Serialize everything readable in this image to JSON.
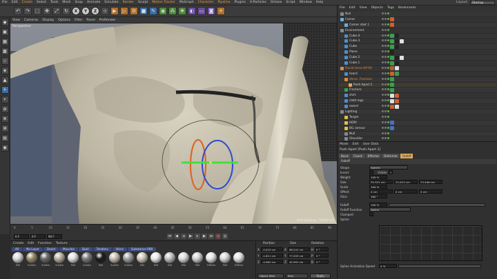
{
  "menubar": {
    "items": [
      "File",
      "Edit",
      "Create",
      "Select",
      "Tools",
      "Mesh",
      "Snap",
      "Animate",
      "Simulate",
      "Render",
      "Sculpt",
      "Motion Tracker",
      "MoGraph",
      "Character",
      "Pipeline",
      "Plugins",
      "X-Particles",
      "Octane",
      "Script",
      "Window",
      "Help"
    ],
    "highlighted": [
      "Create",
      "Render",
      "Motion Tracker",
      "Character",
      "Pipeline"
    ],
    "layout_label": "Layout:",
    "layout_value": "Startup"
  },
  "toolbar": {
    "buttons": [
      "undo-icon",
      "redo-icon",
      "select-icon",
      "move-icon",
      "scale-icon",
      "rotate-icon",
      "x-axis",
      "y-axis",
      "z-axis",
      "coordinate-system-icon",
      "render-view-icon",
      "render-picture-icon",
      "render-settings-icon",
      "cube-icon",
      "pen-icon",
      "subdivision-icon",
      "array-icon",
      "cloner-icon",
      "deformer-icon",
      "floor-icon",
      "camera-icon",
      "light-icon"
    ],
    "axis_labels": [
      "X",
      "Y",
      "Z"
    ]
  },
  "viewport": {
    "menu": [
      "View",
      "Cameras",
      "Display",
      "Options",
      "Filter",
      "Panel",
      "ProRender"
    ],
    "camera_label": "Perspective",
    "grid_spacing": "Grid Spacing : 10000 cm"
  },
  "timeline": {
    "ticks": [
      "0",
      "5",
      "10",
      "15",
      "20",
      "25",
      "30",
      "35",
      "40",
      "45",
      "50",
      "55",
      "60",
      "65",
      "70",
      "75",
      "80",
      "85",
      "90"
    ],
    "start_field": "0 F",
    "current_field": "0 F",
    "end_field": "90 F",
    "playback": [
      "first-frame-icon",
      "prev-key-icon",
      "prev-frame-icon",
      "play-icon",
      "next-frame-icon",
      "next-key-icon",
      "last-frame-icon",
      "record-icon",
      "autokey-icon"
    ]
  },
  "materials": {
    "menu": [
      "Create",
      "Edit",
      "Function",
      "Texture"
    ],
    "tabs": [
      "All",
      "No Layer",
      "David",
      "Muscles",
      "Skull",
      "Tendons",
      "Veins",
      "Substance PBR"
    ],
    "items": [
      {
        "name": "Mat",
        "color": "#d8d8d8"
      },
      {
        "name": "Substa",
        "color": "#9a8a6a"
      },
      {
        "name": "Substa",
        "color": "#6a6a6a"
      },
      {
        "name": "Substa",
        "color": "#b8b0a0"
      },
      {
        "name": "Mat",
        "color": "#e0e0e0"
      },
      {
        "name": "Substa",
        "color": "#7a7a7a"
      },
      {
        "name": "Mat",
        "color": "#1a1a1a"
      },
      {
        "name": "Substa",
        "color": "#c8c0b0"
      },
      {
        "name": "Substa",
        "color": "#a0a0a0"
      },
      {
        "name": "Mat",
        "color": "#d0c8b8"
      },
      {
        "name": "Mat",
        "color": "#e8e8e8"
      },
      {
        "name": "Mat",
        "color": "#c0c0c0"
      },
      {
        "name": "Mat",
        "color": "#dcdcdc"
      },
      {
        "name": "Mat",
        "color": "#cfcfcf"
      },
      {
        "name": "Diffuse",
        "color": "#e4e4e4"
      },
      {
        "name": "Mat",
        "color": "#d6d6d6"
      },
      {
        "name": "Diffuse",
        "color": "#e0e0e0"
      }
    ]
  },
  "coordinates": {
    "headers": [
      "Position",
      "Size",
      "Rotation"
    ],
    "rows": [
      {
        "axis": "X",
        "pos": "-0.019 cm",
        "size": "66.241 cm",
        "rot_label": "H",
        "rot": "0 °"
      },
      {
        "axis": "Y",
        "pos": "-1.811 cm",
        "size": "77.203 cm",
        "rot_label": "P",
        "rot": "0 °"
      },
      {
        "axis": "Z",
        "pos": "-4.982 cm",
        "size": "42.991 cm",
        "rot_label": "B",
        "rot": "0 °"
      }
    ],
    "mode_select": "Object (Rel)",
    "size_select": "Size",
    "apply_label": "Apply"
  },
  "objects": {
    "menu": [
      "File",
      "Edit",
      "View",
      "Objects",
      "Tags",
      "Bookmarks"
    ],
    "rows": [
      {
        "name": "Null",
        "indent": 0,
        "color": "#888888",
        "orange": false,
        "sel": false,
        "tags": []
      },
      {
        "name": "Camer",
        "indent": 0,
        "color": "#6ab0e0",
        "orange": false,
        "sel": false,
        "tags": [
          "#d06030"
        ]
      },
      {
        "name": "Camer shot 1",
        "indent": 1,
        "color": "#6ab0e0",
        "orange": false,
        "sel": false,
        "tags": [
          "#d06030"
        ]
      },
      {
        "name": "Environment",
        "indent": 0,
        "color": "#888888",
        "orange": false,
        "sel": false,
        "tags": []
      },
      {
        "name": "Cube.4",
        "indent": 1,
        "color": "#4a90d0",
        "orange": false,
        "sel": false,
        "tags": [
          "#3aa050",
          "#222222"
        ]
      },
      {
        "name": "Cube.3",
        "indent": 1,
        "color": "#4a90d0",
        "orange": false,
        "sel": false,
        "tags": [
          "#3aa050",
          "#222222",
          "#e0e0e0"
        ]
      },
      {
        "name": "Cube",
        "indent": 1,
        "color": "#4a90d0",
        "orange": false,
        "sel": false,
        "tags": [
          "#3aa050",
          "#222222"
        ]
      },
      {
        "name": "Plane",
        "indent": 1,
        "color": "#4a90d0",
        "orange": false,
        "sel": false,
        "tags": [
          "#222222"
        ]
      },
      {
        "name": "Cube.2",
        "indent": 1,
        "color": "#4a90d0",
        "orange": false,
        "sel": false,
        "tags": [
          "#3aa050",
          "#222222",
          "#e0e0e0"
        ]
      },
      {
        "name": "Cube.1",
        "indent": 1,
        "color": "#4a90d0",
        "orange": false,
        "sel": false,
        "tags": [
          "#3aa050",
          "#222222"
        ]
      },
      {
        "name": "David torso HP-00",
        "indent": 0,
        "color": "#e08a3a",
        "orange": true,
        "sel": false,
        "tags": [
          "#b06030",
          "#e0e0e0"
        ]
      },
      {
        "name": "lizard",
        "indent": 1,
        "color": "#4a90d0",
        "orange": false,
        "sel": false,
        "tags": [
          "#d06030",
          "#3aa050"
        ]
      },
      {
        "name": "Voron. Fracture",
        "indent": 1,
        "color": "#e08a3a",
        "orange": true,
        "sel": false,
        "tags": [
          "#3aa050"
        ]
      },
      {
        "name": "Push Apart.1",
        "indent": 2,
        "color": "#e0a858",
        "orange": false,
        "sel": true,
        "tags": [
          "#3aa050"
        ]
      },
      {
        "name": "Fracture",
        "indent": 1,
        "color": "#3aa050",
        "orange": false,
        "sel": false,
        "tags": [
          "#3aa050"
        ]
      },
      {
        "name": "shirt",
        "indent": 1,
        "color": "#4a90d0",
        "orange": false,
        "sel": false,
        "tags": [
          "#e0e0e0",
          "#d06030"
        ]
      },
      {
        "name": "cloth legs",
        "indent": 1,
        "color": "#4a90d0",
        "orange": false,
        "sel": false,
        "tags": [
          "#e0e0e0",
          "#d06030"
        ]
      },
      {
        "name": "sword",
        "indent": 1,
        "color": "#4a90d0",
        "orange": false,
        "sel": false,
        "tags": [
          "#d06030",
          "#e0e0e0"
        ]
      },
      {
        "name": "Lighting",
        "indent": 0,
        "color": "#888888",
        "orange": false,
        "sel": false,
        "tags": []
      },
      {
        "name": "Target",
        "indent": 1,
        "color": "#e0c040",
        "orange": false,
        "sel": false,
        "tags": []
      },
      {
        "name": "HDRI",
        "indent": 1,
        "color": "#e0c040",
        "orange": false,
        "sel": false,
        "tags": [
          "#4a70c0"
        ]
      },
      {
        "name": "BG.ramour",
        "indent": 1,
        "color": "#e0c040",
        "orange": false,
        "sel": false,
        "tags": [
          "#4a70c0"
        ]
      },
      {
        "name": "Null",
        "indent": 1,
        "color": "#888888",
        "orange": false,
        "sel": false,
        "tags": []
      },
      {
        "name": "Shoulder",
        "indent": 1,
        "color": "#888888",
        "orange": false,
        "sel": false,
        "tags": []
      }
    ]
  },
  "attributes": {
    "menu": [
      "Mode",
      "Edit",
      "User Data"
    ],
    "title": "Push Apart [Push Apart.1]",
    "tabs": [
      "Basic",
      "Coord.",
      "Effector",
      "Deformer",
      "Falloff"
    ],
    "active_tab": "Falloff",
    "section": "Falloff",
    "shape_label": "Shape",
    "shape_value": "Sphere",
    "invert_label": "Invert",
    "visible_label": "Visible",
    "weight_label": "Weight",
    "weight_value": "100 %",
    "size_label": "Size",
    "size_x": "55.321 cm",
    "size_y": "21.013 cm",
    "size_z": "23.446 cm",
    "scale_label": "Scale",
    "scale_value": "100 %",
    "offset_label": "Offset",
    "offset_x": "0 cm",
    "offset_y": "0 cm",
    "offset_z": "0 cm",
    "slice_label": "Slice",
    "slice_value": "360 °",
    "falloff_label": "Falloff",
    "falloff_value": "100 %",
    "falloff_fn_label": "Falloff Function",
    "falloff_fn_value": "Spline",
    "clamped_label": "Clamped",
    "spline_label": "Spline",
    "spline_anim_label": "Spline Animation Speed",
    "spline_anim_value": "0 %"
  }
}
